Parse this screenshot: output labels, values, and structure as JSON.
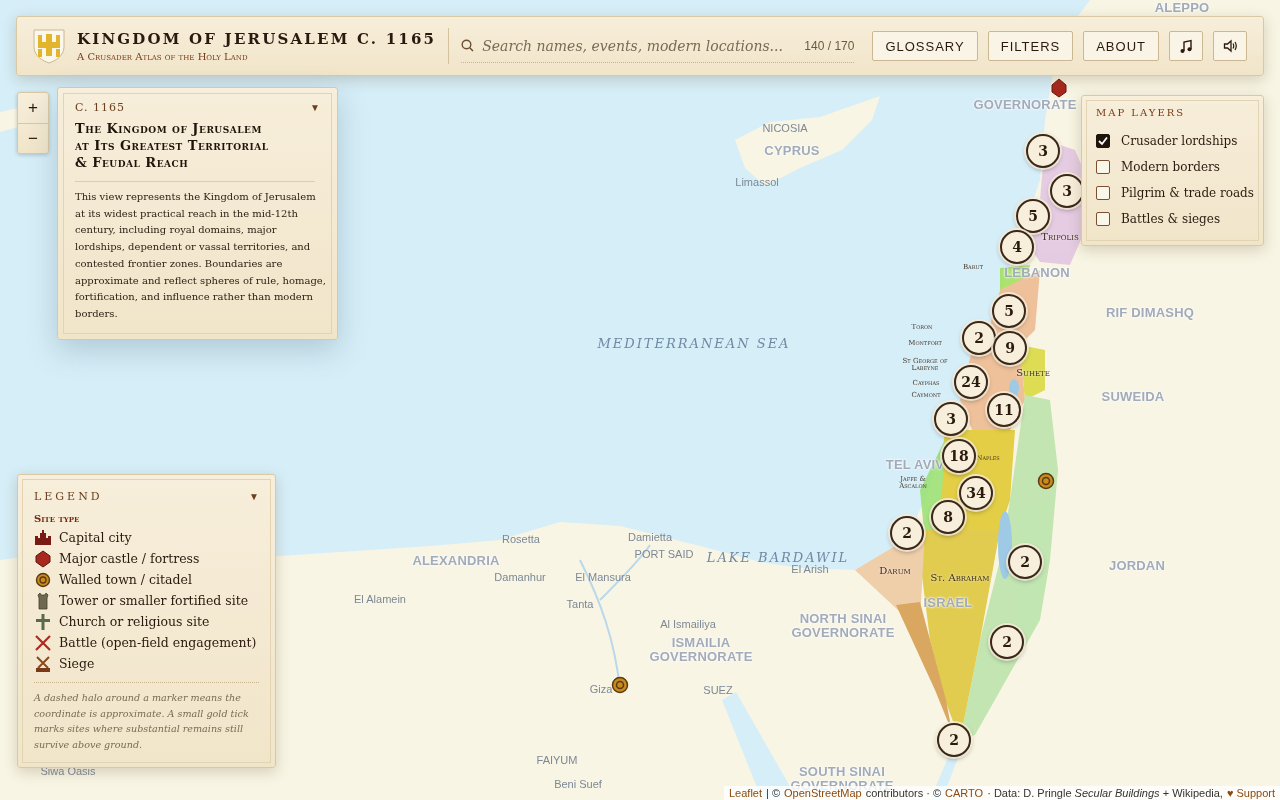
{
  "header": {
    "title": "KINGDOM OF JERUSALEM C. 1165",
    "subtitle": "A Crusader Atlas of the Holy Land",
    "search": {
      "placeholder": "Search names, events, modern locations...",
      "count": "140 / 170"
    },
    "buttons": [
      "GLOSSARY",
      "FILTERS",
      "ABOUT"
    ]
  },
  "zoom_controls": [
    "+",
    "−"
  ],
  "info_panel": {
    "date": "C. 1165",
    "toggle": "▼",
    "expanded": true,
    "title": "The Kingdom of Jerusalem at Its Greatest Territorial & Feudal Reach",
    "body": "This view represents the Kingdom of Jerusalem at its widest practical reach in the mid-12th century, including royal domains, major lordships, dependent or vassal territories, and contested frontier zones. Boundaries are approximate and reflect spheres of rule, homage, fortification, and influence rather than modern borders."
  },
  "map_layers": {
    "title": "MAP LAYERS",
    "items": [
      {
        "label": "Crusader lordships",
        "checked": true
      },
      {
        "label": "Modern borders",
        "checked": false
      },
      {
        "label": "Pilgrim & trade roads",
        "checked": false
      },
      {
        "label": "Battles & sieges",
        "checked": false
      }
    ]
  },
  "legend": {
    "title": "LEGEND",
    "toggle": "▼",
    "expanded": true,
    "section": "Site type",
    "items": [
      {
        "kind": "capital",
        "label": "Capital city"
      },
      {
        "kind": "castle",
        "label": "Major castle / fortress"
      },
      {
        "kind": "town",
        "label": "Walled town / citadel"
      },
      {
        "kind": "tower",
        "label": "Tower or smaller fortified site"
      },
      {
        "kind": "church",
        "label": "Church or religious site"
      },
      {
        "kind": "battle",
        "label": "Battle (open-field engagement)"
      },
      {
        "kind": "siege",
        "label": "Siege"
      }
    ],
    "note": "A dashed halo around a marker means the coordinate is approximate. A small gold tick marks sites where substantial remains still survive above ground."
  },
  "map": {
    "labels": [
      {
        "text": "ALEPPO",
        "kind": "region"
      },
      {
        "text": "GOVERNORATE",
        "kind": "region"
      },
      {
        "text": "NICOSIA",
        "kind": "city"
      },
      {
        "text": "CYPRUS",
        "kind": "region"
      },
      {
        "text": "Limassol",
        "kind": "city"
      },
      {
        "text": "MEDITERRANEAN SEA",
        "kind": "sea"
      },
      {
        "text": "LEBANON",
        "kind": "region"
      },
      {
        "text": "RIF DIMASHQ",
        "kind": "region"
      },
      {
        "text": "SUWEIDA",
        "kind": "region"
      },
      {
        "text": "TEL AVIV",
        "kind": "region"
      },
      {
        "text": "JORDAN",
        "kind": "region"
      },
      {
        "text": "Rosetta",
        "kind": "city"
      },
      {
        "text": "Damietta",
        "kind": "city"
      },
      {
        "text": "ALEXANDRIA",
        "kind": "region"
      },
      {
        "text": "PORT SAID",
        "kind": "city"
      },
      {
        "text": "LAKE BARDAWIL",
        "kind": "sea"
      },
      {
        "text": "Damanhur",
        "kind": "city"
      },
      {
        "text": "El Mansura",
        "kind": "city"
      },
      {
        "text": "El Arish",
        "kind": "city"
      },
      {
        "text": "El Alamein",
        "kind": "city"
      },
      {
        "text": "Tanta",
        "kind": "city"
      },
      {
        "text": "Al Ismailiya",
        "kind": "city"
      },
      {
        "text": "NORTH SINAI GOVERNORATE",
        "kind": "region"
      },
      {
        "text": "ISMAILIA GOVERNORATE",
        "kind": "region"
      },
      {
        "text": "SUEZ",
        "kind": "city"
      },
      {
        "text": "Giza",
        "kind": "city"
      },
      {
        "text": "FAIYUM",
        "kind": "city"
      },
      {
        "text": "Beni Suef",
        "kind": "city"
      },
      {
        "text": "Siwa Oasis",
        "kind": "city"
      },
      {
        "text": "SOUTH SINAI GOVERNORATE",
        "kind": "region"
      },
      {
        "text": "Tripolis",
        "kind": "territory"
      },
      {
        "text": "Suhete",
        "kind": "territory"
      },
      {
        "text": "Darum",
        "kind": "territory"
      },
      {
        "text": "St. Abraham",
        "kind": "territory"
      },
      {
        "text": "ISRAEL",
        "kind": "region"
      },
      {
        "text": "Barut",
        "kind": "site"
      },
      {
        "text": "Toron",
        "kind": "site"
      },
      {
        "text": "Montfort",
        "kind": "site"
      },
      {
        "text": "St George of Labeyne",
        "kind": "site"
      },
      {
        "text": "Cayphas",
        "kind": "site"
      },
      {
        "text": "Caymont",
        "kind": "site"
      },
      {
        "text": "Jaffe & Ascalon",
        "kind": "site"
      },
      {
        "text": "Naples",
        "kind": "site"
      }
    ],
    "clusters": [
      {
        "count": "3"
      },
      {
        "count": "3"
      },
      {
        "count": "5"
      },
      {
        "count": "4"
      },
      {
        "count": "5"
      },
      {
        "count": "2"
      },
      {
        "count": "9"
      },
      {
        "count": "24"
      },
      {
        "count": "11"
      },
      {
        "count": "3"
      },
      {
        "count": "18"
      },
      {
        "count": "34"
      },
      {
        "count": "8"
      },
      {
        "count": "2"
      },
      {
        "count": "2"
      },
      {
        "count": "2"
      },
      {
        "count": "2"
      }
    ],
    "markers": [
      {
        "kind": "castle"
      },
      {
        "kind": "town"
      },
      {
        "kind": "town"
      }
    ]
  },
  "attribution": [
    {
      "kind": "link",
      "text": "Leaflet"
    },
    {
      "kind": "text",
      "text": "| ©"
    },
    {
      "kind": "link",
      "text": "OpenStreetMap"
    },
    {
      "kind": "text",
      "text": "contributors · ©"
    },
    {
      "kind": "link",
      "text": "CARTO"
    },
    {
      "kind": "text",
      "text": "· Data: D. Pringle *Secular Buildings* + Wikipedia,"
    },
    {
      "kind": "link",
      "text": "♥ Support"
    }
  ]
}
